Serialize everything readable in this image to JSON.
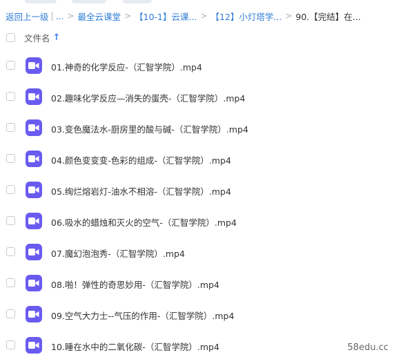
{
  "breadcrumb": {
    "back": "返回上一级",
    "ellipsis": "...",
    "items": [
      "最全云课堂",
      "【10-1】云课...",
      "【12】小灯塔学...",
      "90.【完结】在..."
    ]
  },
  "list_header": {
    "column_name": "文件名",
    "sort_icon": "arrow-up-icon"
  },
  "files": [
    "01.神奇的化学反应-（汇智学院）.mp4",
    "02.趣味化学反应—消失的蛋壳-（汇智学院）.mp4",
    "03.变色魔法水-厨房里的酸与碱-（汇智学院）.mp4",
    "04.颜色变变变-色彩的组成-（汇智学院）.mp4",
    "05.绚烂熔岩灯-油水不相溶-（汇智学院）.mp4",
    "06.吸水的蜡烛和灭火的空气-（汇智学院）.mp4",
    "07.魔幻泡泡秀-（汇智学院）.mp4",
    "08.啪！弹性的奇思妙用-（汇智学院）.mp4",
    "09.空气大力士--气压的作用-（汇智学院）.mp4",
    "10.睡在水中的二氧化碳-（汇智学院）.mp4"
  ],
  "watermark": "58edu.cc",
  "colors": {
    "link": "#2f7dd6",
    "video_icon": "#6a5bf0"
  }
}
